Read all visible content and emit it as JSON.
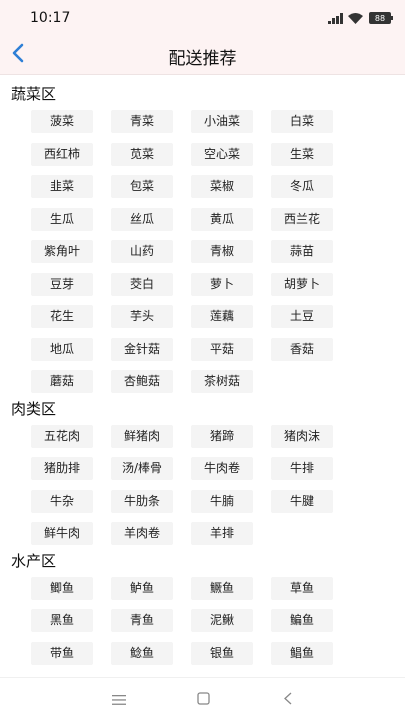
{
  "status": {
    "time": "10:17",
    "battery": "88"
  },
  "header": {
    "title": "配送推荐"
  },
  "sections": [
    {
      "title": "蔬菜区",
      "items": [
        "菠菜",
        "青菜",
        "小油菜",
        "白菜",
        "西红柿",
        "苋菜",
        "空心菜",
        "生菜",
        "韭菜",
        "包菜",
        "菜椒",
        "冬瓜",
        "生瓜",
        "丝瓜",
        "黄瓜",
        "西兰花",
        "紫角叶",
        "山药",
        "青椒",
        "蒜苗",
        "豆芽",
        "茭白",
        "萝卜",
        "胡萝卜",
        "花生",
        "芋头",
        "莲藕",
        "土豆",
        "地瓜",
        "金针菇",
        "平菇",
        "香菇",
        "蘑菇",
        "杏鲍菇",
        "茶树菇"
      ]
    },
    {
      "title": "肉类区",
      "items": [
        "五花肉",
        "鲜猪肉",
        "猪蹄",
        "猪肉沫",
        "猪肋排",
        "汤/棒骨",
        "牛肉卷",
        "牛排",
        "牛杂",
        "牛肋条",
        "牛腩",
        "牛腱",
        "鲜牛肉",
        "羊肉卷",
        "羊排"
      ]
    },
    {
      "title": "水产区",
      "items": [
        "鲫鱼",
        "鲈鱼",
        "鳜鱼",
        "草鱼",
        "黑鱼",
        "青鱼",
        "泥鳅",
        "鳊鱼",
        "带鱼",
        "鲶鱼",
        "银鱼",
        "鲳鱼"
      ]
    }
  ]
}
